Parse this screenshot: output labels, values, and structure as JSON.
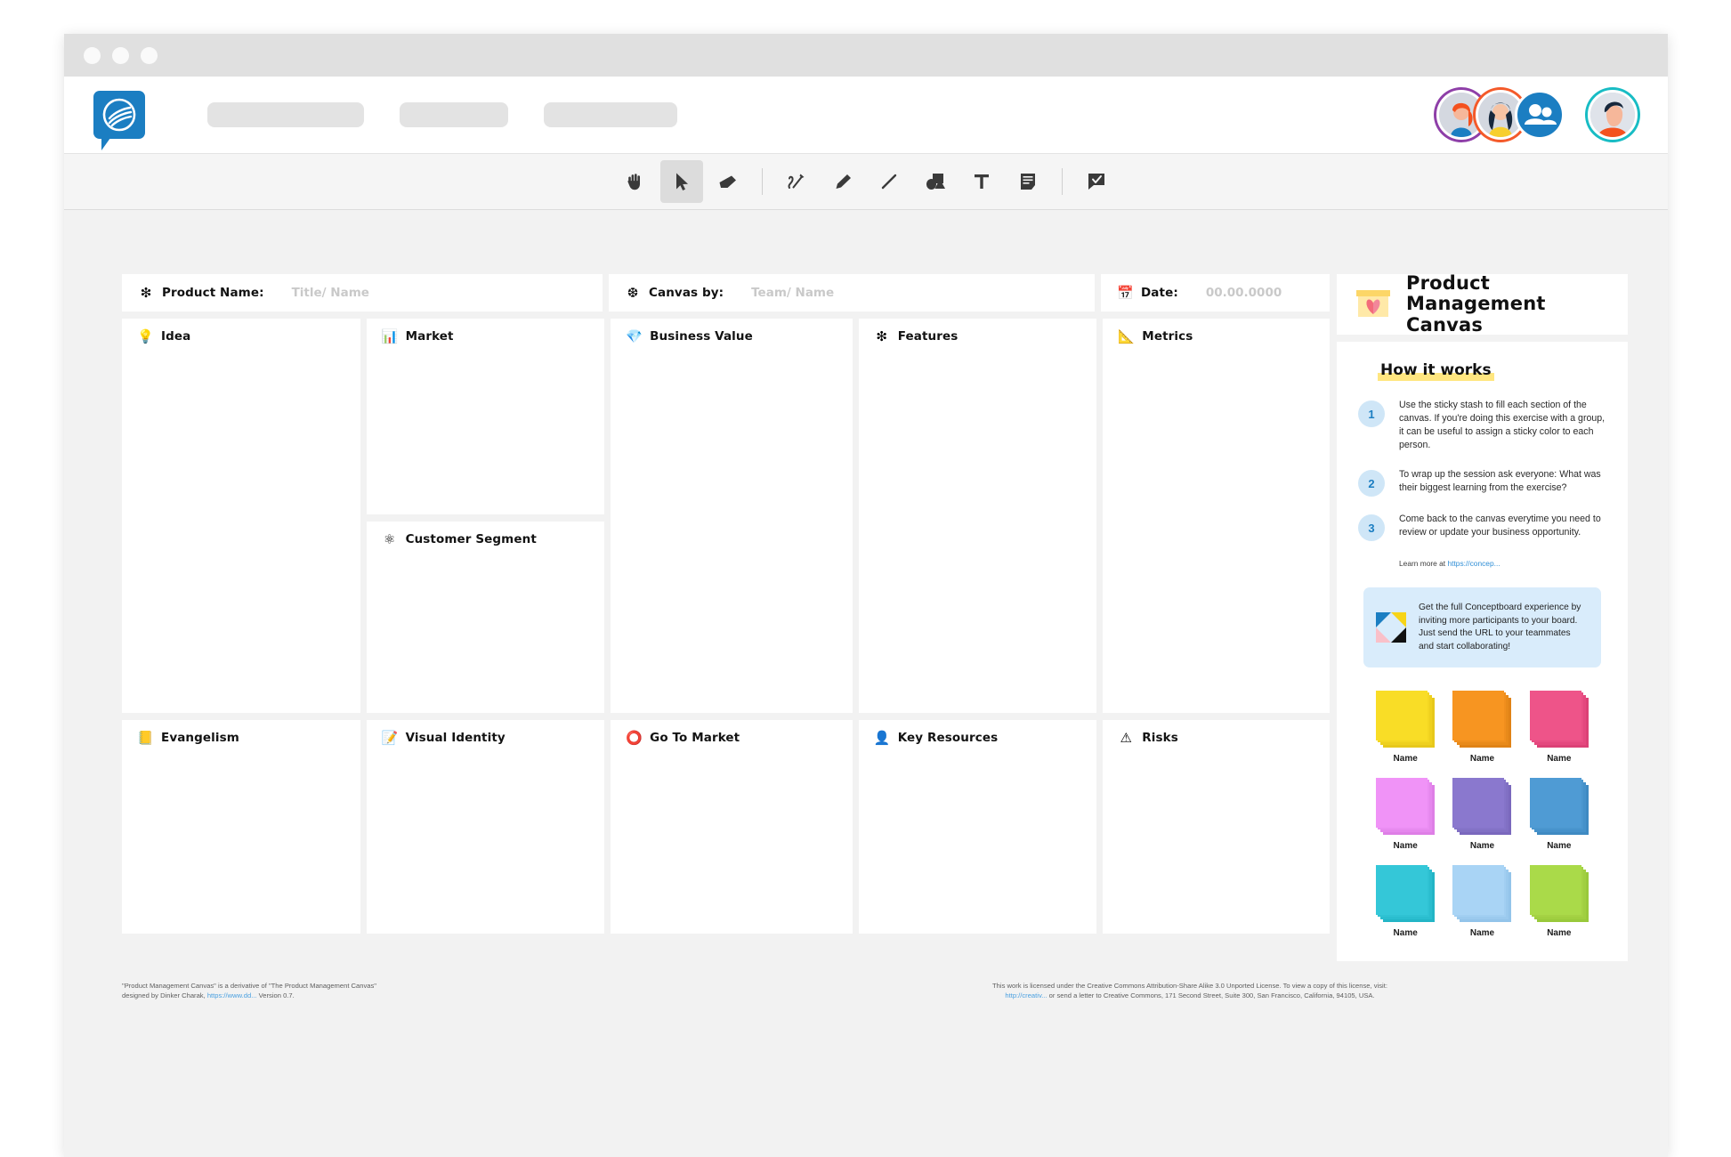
{
  "window": {
    "dots": [
      "close",
      "minimize",
      "maximize"
    ]
  },
  "header": {
    "logo_name": "conceptboard-logo",
    "placeholders": [
      "",
      "",
      ""
    ],
    "avatars": [
      {
        "name": "avatar-user-1",
        "ring": "#8e3fa8"
      },
      {
        "name": "avatar-user-2",
        "ring": "#f45a2a"
      },
      {
        "name": "avatar-group",
        "ring": "#1b7ec2"
      },
      {
        "name": "avatar-me",
        "ring": "#18bcc4"
      }
    ]
  },
  "toolbar": {
    "tools": [
      {
        "name": "hand-tool",
        "label": "Pan",
        "active": false
      },
      {
        "name": "select-tool",
        "label": "Select",
        "active": true
      },
      {
        "name": "eraser-tool",
        "label": "Eraser",
        "active": false
      },
      {
        "name": "pen-tool",
        "label": "Pen",
        "active": false
      },
      {
        "name": "highlighter-tool",
        "label": "Highlighter",
        "active": false
      },
      {
        "name": "line-tool",
        "label": "Line",
        "active": false
      },
      {
        "name": "shape-tool",
        "label": "Shapes",
        "active": false
      },
      {
        "name": "text-tool",
        "label": "Text",
        "active": false
      },
      {
        "name": "sticky-note-tool",
        "label": "Sticky note",
        "active": false
      },
      {
        "name": "comment-tool",
        "label": "Comment",
        "active": false
      }
    ]
  },
  "meta": {
    "product_name_label": "Product Name:",
    "product_name_placeholder": "Title/ Name",
    "canvas_by_label": "Canvas by:",
    "canvas_by_placeholder": "Team/ Name",
    "date_label": "Date:",
    "date_placeholder": "00.00.0000"
  },
  "sections": {
    "idea": {
      "title": "Idea",
      "emoji": "💡"
    },
    "market": {
      "title": "Market",
      "emoji": "📊"
    },
    "customer_segment": {
      "title": "Customer Segment",
      "emoji": "⚛"
    },
    "business_value": {
      "title": "Business Value",
      "emoji": "💎"
    },
    "features": {
      "title": "Features",
      "emoji": "❇"
    },
    "metrics": {
      "title": "Metrics",
      "emoji": "📐"
    },
    "evangelism": {
      "title": "Evangelism",
      "emoji": "📒"
    },
    "visual_identity": {
      "title": "Visual Identity",
      "emoji": "📝"
    },
    "go_to_market": {
      "title": "Go To Market",
      "emoji": "⭕"
    },
    "key_resources": {
      "title": "Key Resources",
      "emoji": "👤"
    },
    "risks": {
      "title": "Risks",
      "emoji": "⚠"
    }
  },
  "sidebar": {
    "title": "Product\nManagement Canvas",
    "title_line1": "Product",
    "title_line2": "Management Canvas",
    "how_it_works": "How it works",
    "steps": [
      {
        "num": "1",
        "text": "Use the sticky stash to fill each section of the canvas. If you're doing this exercise with a group, it can be useful to assign a sticky color to each person."
      },
      {
        "num": "2",
        "text": "To wrap up the session ask everyone: What was their biggest learning from the exercise?"
      },
      {
        "num": "3",
        "text": "Come back to the canvas everytime you need to review or update your business opportunity."
      }
    ],
    "learn_more_prefix": "Learn more at ",
    "learn_more_link": "https://concep...",
    "promo_text": "Get the full Conceptboard experience by inviting more participants to your board. Just send the URL to your teammates and start collaborating!",
    "stash": [
      {
        "name": "Name",
        "color": "#f9dd26",
        "shade": "#e7c81b"
      },
      {
        "name": "Name",
        "color": "#f79521",
        "shade": "#e08216"
      },
      {
        "name": "Name",
        "color": "#ee5489",
        "shade": "#dc4176"
      },
      {
        "name": "Name",
        "color": "#f093f7",
        "shade": "#de7fe6"
      },
      {
        "name": "Name",
        "color": "#8a78ce",
        "shade": "#7a68bd"
      },
      {
        "name": "Name",
        "color": "#4f9bd4",
        "shade": "#3f8ac2"
      },
      {
        "name": "Name",
        "color": "#34c7d8",
        "shade": "#23b5c6"
      },
      {
        "name": "Name",
        "color": "#a9d4f5",
        "shade": "#93c4ea"
      },
      {
        "name": "Name",
        "color": "#aada49",
        "shade": "#99c93b"
      }
    ]
  },
  "footer": {
    "left_line1": "\"Product Management Canvas\" is a derivative of \"The Product Management Canvas\"",
    "left_line2_prefix": "designed by Dinker Charak, ",
    "left_link": "https://www.dd...",
    "left_line2_suffix": " Version 0.7.",
    "right_line1": "This work is licensed under the Creative Commons Attribution-Share Alike 3.0 Unported License. To view a copy of this license, visit:",
    "right_link": "http://creativ...",
    "right_line2_suffix": " or send a letter to Creative Commons, 171 Second Street, Suite 300, San Francisco, California, 94105, USA."
  }
}
